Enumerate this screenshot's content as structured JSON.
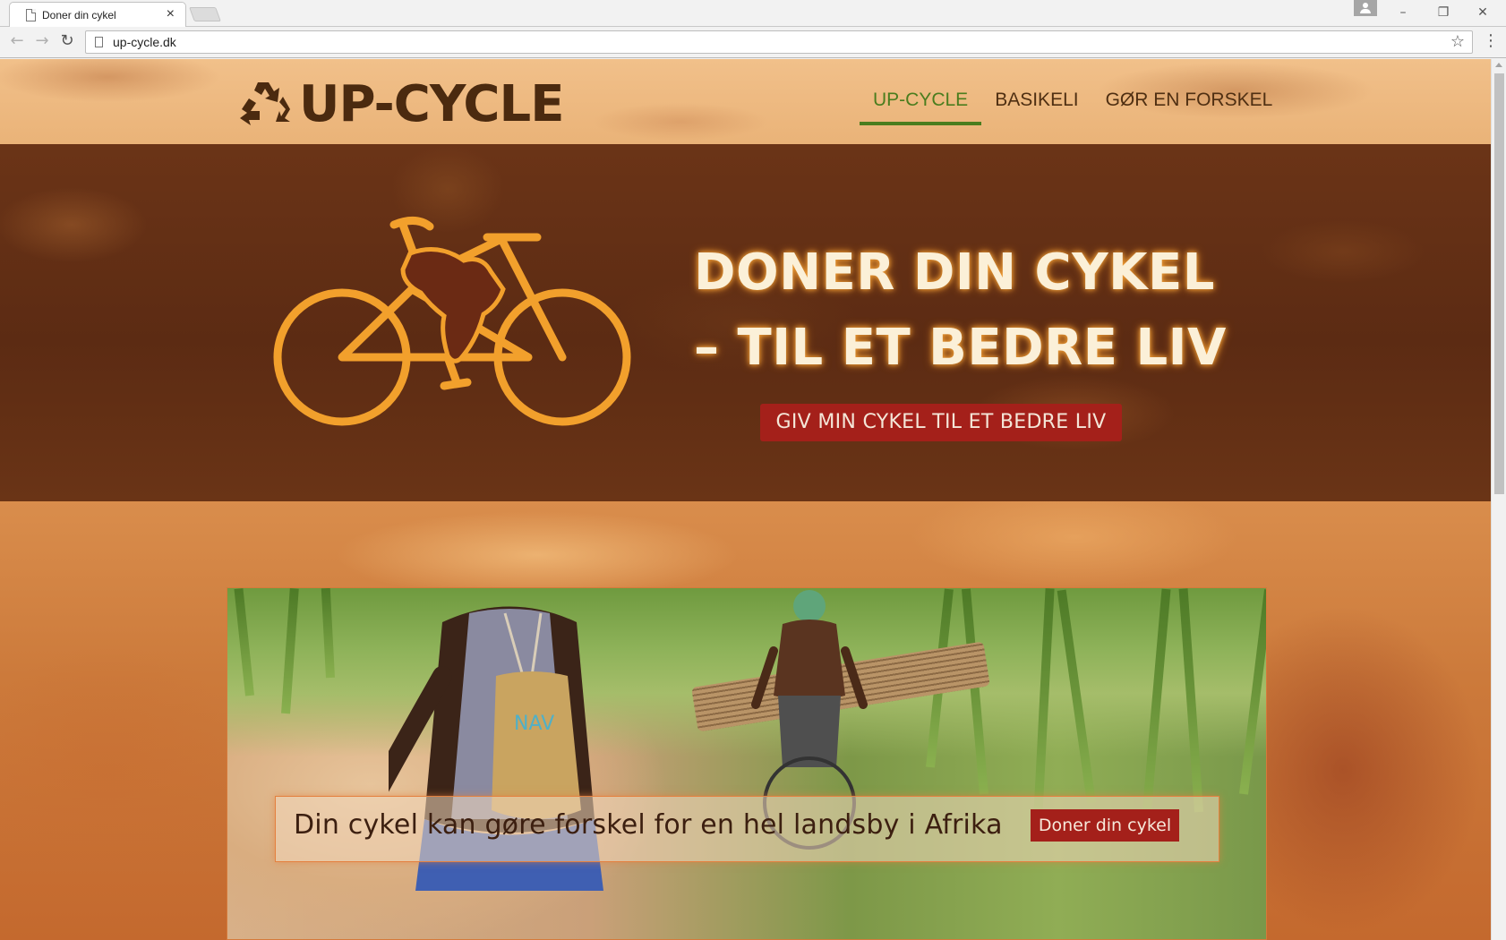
{
  "browser": {
    "tab_title": "Doner din cykel",
    "tab_close": "×",
    "url": "up-cycle.dk",
    "win_minimize": "–",
    "win_maximize": "❐",
    "win_close": "✕"
  },
  "site": {
    "logo_text": "UP-CYCLE",
    "nav": [
      {
        "label": "UP-CYCLE",
        "active": true
      },
      {
        "label": "BASIKELI",
        "active": false
      },
      {
        "label": "GØR EN FORSKEL",
        "active": false
      }
    ],
    "hero": {
      "title_line1": "DONER DIN CYKEL",
      "title_line2": "– TIL ET BEDRE LIV",
      "cta_label": "GIV MIN CYKEL TIL ET BEDRE LIV"
    },
    "banner": {
      "text": "Din cykel kan gøre forskel for en hel landsby i Afrika",
      "button_label": "Doner din cykel"
    },
    "colors": {
      "brand_dark": "#4b2a0f",
      "nav_active": "#4a7d1e",
      "cta_red": "#a4201a",
      "bike_orange": "#f2a02c"
    },
    "icons": [
      "recycle-icon",
      "bicycle-africa-icon"
    ]
  }
}
